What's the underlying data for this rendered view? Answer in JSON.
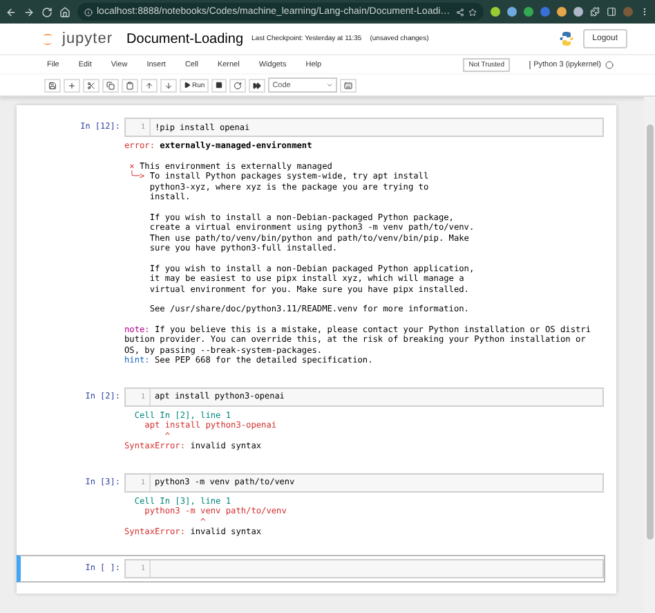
{
  "browser": {
    "url": "localhost:8888/notebooks/Codes/machine_learning/Lang-chain/Document-Loadi…"
  },
  "header": {
    "logo_text": "jupyter",
    "title": "Document-Loading",
    "checkpoint": "Last Checkpoint: Yesterday at 11:35",
    "save_status": "(unsaved changes)",
    "logout": "Logout"
  },
  "menu": {
    "items": [
      "File",
      "Edit",
      "View",
      "Insert",
      "Cell",
      "Kernel",
      "Widgets",
      "Help"
    ],
    "trust": "Not Trusted",
    "kernel": "Python 3 (ipykernel)"
  },
  "toolbar": {
    "run": "Run",
    "cell_type": "Code"
  },
  "cells": [
    {
      "prompt": "In [12]:",
      "line_number": "1",
      "code": "!pip install openai",
      "selected": false,
      "output": [
        [
          [
            {
              "text": "error:",
              "kind": "error"
            },
            {
              "text": " externally-managed-environment",
              "kind": "emphasis"
            }
          ]
        ],
        [
          [
            {
              "text": " ×",
              "kind": "error"
            },
            {
              "text": " This environment is externally managed",
              "kind": "plain"
            }
          ],
          [
            {
              "text": " ╰─>",
              "kind": "error"
            },
            {
              "text": " To install Python packages system-wide, try apt install",
              "kind": "plain"
            }
          ],
          [
            {
              "text": "     python3-xyz, where xyz is the package you are trying to",
              "kind": "plain"
            }
          ],
          [
            {
              "text": "     install.",
              "kind": "plain"
            }
          ]
        ],
        [
          [
            {
              "text": "     If you wish to install a non-Debian-packaged Python package,",
              "kind": "plain"
            }
          ],
          [
            {
              "text": "     create a virtual environment using python3 -m venv path/to/venv.",
              "kind": "plain"
            }
          ],
          [
            {
              "text": "     Then use path/to/venv/bin/python and path/to/venv/bin/pip. Make",
              "kind": "plain"
            }
          ],
          [
            {
              "text": "     sure you have python3-full installed.",
              "kind": "plain"
            }
          ]
        ],
        [
          [
            {
              "text": "     If you wish to install a non-Debian packaged Python application,",
              "kind": "plain"
            }
          ],
          [
            {
              "text": "     it may be easiest to use pipx install xyz, which will manage a",
              "kind": "plain"
            }
          ],
          [
            {
              "text": "     virtual environment for you. Make sure you have pipx installed.",
              "kind": "plain"
            }
          ]
        ],
        [
          [
            {
              "text": "     See /usr/share/doc/python3.11/README.venv for more information.",
              "kind": "plain"
            }
          ]
        ],
        [
          [
            {
              "text": "note:",
              "kind": "note"
            },
            {
              "text": " If you believe this is a mistake, please contact your Python installation or OS distri",
              "kind": "plain"
            }
          ],
          [
            {
              "text": "bution provider. You can override this, at the risk of breaking your Python installation or",
              "kind": "plain"
            }
          ],
          [
            {
              "text": "OS, by passing --break-system-packages.",
              "kind": "plain"
            }
          ],
          [
            {
              "text": "hint:",
              "kind": "hint"
            },
            {
              "text": " See PEP 668 for the detailed specification.",
              "kind": "plain"
            }
          ]
        ]
      ]
    },
    {
      "prompt": "In [2]:",
      "line_number": "1",
      "code": "apt install python3-openai",
      "selected": false,
      "output": [
        [
          [
            {
              "text": "  Cell In [2], line 1",
              "kind": "location"
            }
          ],
          [
            {
              "text": "    apt install python3-openai",
              "kind": "error"
            }
          ],
          [
            {
              "text": "        ^",
              "kind": "error"
            }
          ],
          [
            {
              "text": "SyntaxError:",
              "kind": "error"
            },
            {
              "text": " invalid syntax",
              "kind": "plain"
            }
          ]
        ]
      ]
    },
    {
      "prompt": "In [3]:",
      "line_number": "1",
      "code": "python3 -m venv path/to/venv",
      "selected": false,
      "output": [
        [
          [
            {
              "text": "  Cell In [3], line 1",
              "kind": "location"
            }
          ],
          [
            {
              "text": "    python3 -m venv path/to/venv",
              "kind": "error"
            }
          ],
          [
            {
              "text": "               ^",
              "kind": "error"
            }
          ],
          [
            {
              "text": "SyntaxError:",
              "kind": "error"
            },
            {
              "text": " invalid syntax",
              "kind": "plain"
            }
          ]
        ]
      ]
    },
    {
      "prompt": "In [ ]:",
      "line_number": "1",
      "selected": true
    }
  ]
}
